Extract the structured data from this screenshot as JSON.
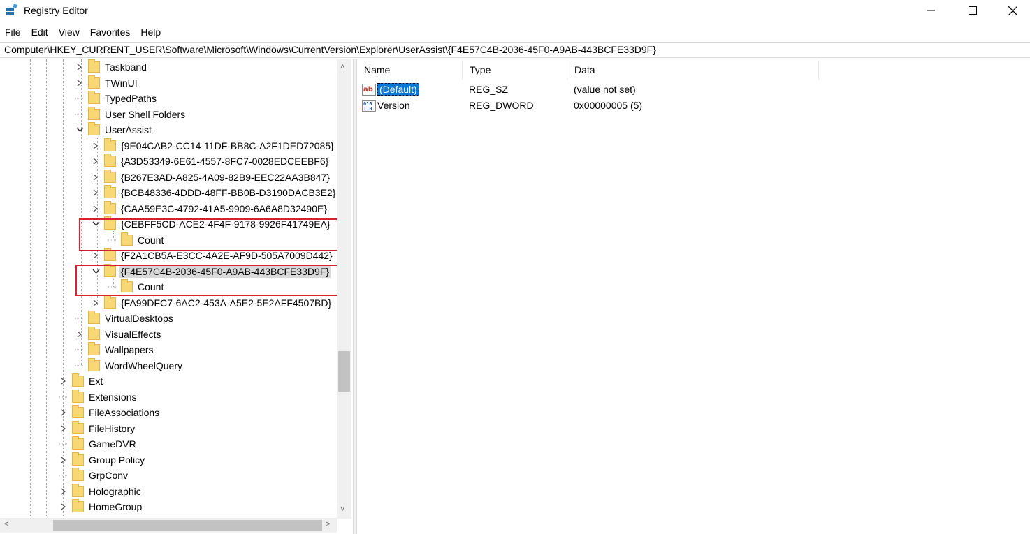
{
  "window": {
    "title": "Registry Editor"
  },
  "menu": [
    "File",
    "Edit",
    "View",
    "Favorites",
    "Help"
  ],
  "address": "Computer\\HKEY_CURRENT_USER\\Software\\Microsoft\\Windows\\CurrentVersion\\Explorer\\UserAssist\\{F4E57C4B-2036-45F0-A9AB-443BCFE33D9F}",
  "tree": [
    {
      "label": "Taskband",
      "expander": "collapsed"
    },
    {
      "label": "TWinUI",
      "expander": "collapsed"
    },
    {
      "label": "TypedPaths",
      "expander": "none"
    },
    {
      "label": "User Shell Folders",
      "expander": "none"
    },
    {
      "label": "UserAssist",
      "expander": "expanded"
    },
    {
      "label": "{9E04CAB2-CC14-11DF-BB8C-A2F1DED72085}",
      "expander": "collapsed"
    },
    {
      "label": "{A3D53349-6E61-4557-8FC7-0028EDCEEBF6}",
      "expander": "collapsed"
    },
    {
      "label": "{B267E3AD-A825-4A09-82B9-EEC22AA3B847}",
      "expander": "collapsed"
    },
    {
      "label": "{BCB48336-4DDD-48FF-BB0B-D3190DACB3E2}",
      "expander": "collapsed"
    },
    {
      "label": "{CAA59E3C-4792-41A5-9909-6A6A8D32490E}",
      "expander": "collapsed"
    },
    {
      "label": "{CEBFF5CD-ACE2-4F4F-9178-9926F41749EA}",
      "expander": "expanded"
    },
    {
      "label": "Count",
      "expander": "none"
    },
    {
      "label": "{F2A1CB5A-E3CC-4A2E-AF9D-505A7009D442}",
      "expander": "collapsed"
    },
    {
      "label": "{F4E57C4B-2036-45F0-A9AB-443BCFE33D9F}",
      "expander": "expanded",
      "selected": true
    },
    {
      "label": "Count",
      "expander": "none"
    },
    {
      "label": "{FA99DFC7-6AC2-453A-A5E2-5E2AFF4507BD}",
      "expander": "collapsed"
    },
    {
      "label": "VirtualDesktops",
      "expander": "none"
    },
    {
      "label": "VisualEffects",
      "expander": "collapsed"
    },
    {
      "label": "Wallpapers",
      "expander": "none"
    },
    {
      "label": "WordWheelQuery",
      "expander": "none"
    },
    {
      "label": "Ext",
      "expander": "collapsed"
    },
    {
      "label": "Extensions",
      "expander": "none"
    },
    {
      "label": "FileAssociations",
      "expander": "collapsed"
    },
    {
      "label": "FileHistory",
      "expander": "collapsed"
    },
    {
      "label": "GameDVR",
      "expander": "none"
    },
    {
      "label": "Group Policy",
      "expander": "collapsed"
    },
    {
      "label": "GrpConv",
      "expander": "none"
    },
    {
      "label": "Holographic",
      "expander": "collapsed"
    },
    {
      "label": "HomeGroup",
      "expander": "collapsed"
    }
  ],
  "list": {
    "columns": [
      "Name",
      "Type",
      "Data"
    ],
    "rows": [
      {
        "icon": "string-value-icon",
        "name": "(Default)",
        "type": "REG_SZ",
        "data": "(value not set)",
        "selected": true
      },
      {
        "icon": "dword-value-icon",
        "name": "Version",
        "type": "REG_DWORD",
        "data": "0x00000005 (5)"
      }
    ]
  },
  "colors": {
    "highlight_box": "#d9212e",
    "selection_blue": "#0078d7",
    "folder_yellow": "#f8d775"
  }
}
